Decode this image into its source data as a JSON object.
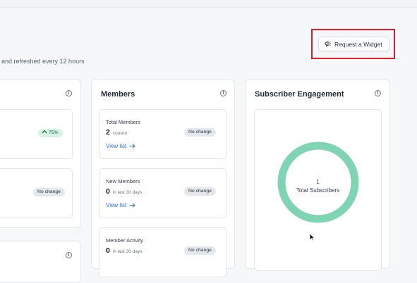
{
  "header": {
    "subtitle": "and refreshed every 12 hours",
    "request_widget_label": "Request a Widget"
  },
  "left_card": {
    "stat1_badge": "75%",
    "stat2_badge": "No change"
  },
  "members_card": {
    "title": "Members",
    "total": {
      "label": "Total Members",
      "value": "2",
      "unit": "current",
      "badge": "No change",
      "link": "View list"
    },
    "new": {
      "label": "New Members",
      "value": "0",
      "unit": "in last 30 days",
      "badge": "No change",
      "link": "View list"
    },
    "activity": {
      "label": "Member Activity",
      "value": "0",
      "unit": "in last 30 days",
      "badge": "No change"
    }
  },
  "engagement_card": {
    "title": "Subscriber Engagement",
    "donut_value": "1",
    "donut_label": "Total Subscribers",
    "donut_color": "#7fd4b4"
  },
  "icons": {
    "request_widget": "megaphone-icon",
    "info": "info-icon",
    "trend_up": "chevron-up-icon",
    "arrow": "arrow-right-icon"
  }
}
